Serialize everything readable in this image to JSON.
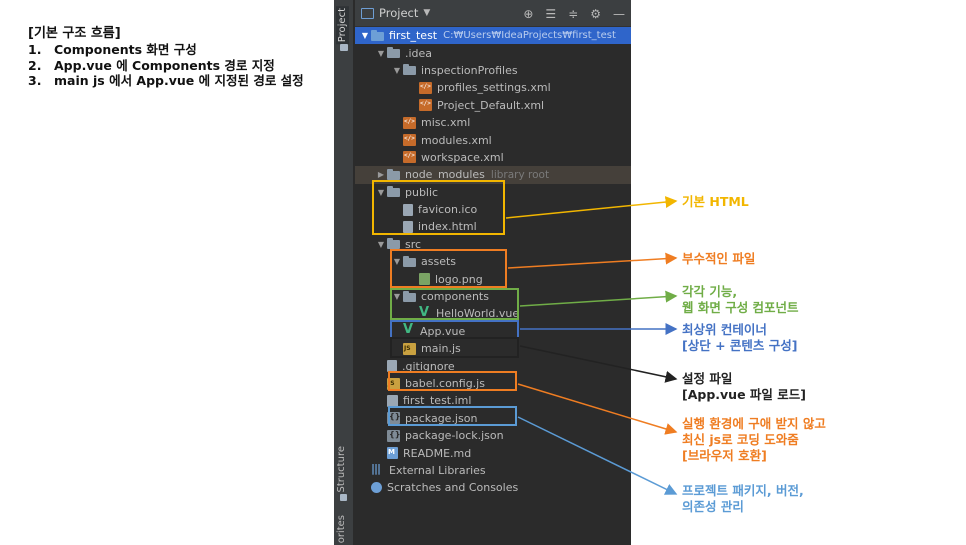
{
  "notes": {
    "title": "[기본 구조 흐름]",
    "items": [
      {
        "num": "1.",
        "text": "Components 화면 구성"
      },
      {
        "num": "2.",
        "text": "App.vue 에 Components 경로 지정"
      },
      {
        "num": "3.",
        "text": "main js 에서 App.vue 에 지정된 경로 설정"
      }
    ]
  },
  "ide": {
    "sidebar": {
      "project_tab": "Project",
      "structure_tab": "Structure",
      "favorites_tab": "orites"
    },
    "toolbar": {
      "view_label": "Project",
      "caret": "▼",
      "icons": [
        "target-icon",
        "collapse-all-icon",
        "expand-all-icon",
        "gear-icon",
        "minimize-icon"
      ]
    },
    "tree": [
      {
        "label": "first_test",
        "path": "C:₩Users₩IdeaProjects₩first_test",
        "icon": "folder-blue",
        "arrow": "▼",
        "indent": 0,
        "selected": true
      },
      {
        "label": ".idea",
        "icon": "folder",
        "arrow": "▼",
        "indent": 1
      },
      {
        "label": "inspectionProfiles",
        "icon": "folder",
        "arrow": "▼",
        "indent": 2
      },
      {
        "label": "profiles_settings.xml",
        "icon": "xml",
        "indent": 3
      },
      {
        "label": "Project_Default.xml",
        "icon": "xml",
        "indent": 3
      },
      {
        "label": "misc.xml",
        "icon": "xml",
        "indent": 2
      },
      {
        "label": "modules.xml",
        "icon": "xml",
        "indent": 2
      },
      {
        "label": "workspace.xml",
        "icon": "xml",
        "indent": 2
      },
      {
        "label": "node_modules",
        "suffix": "library root",
        "icon": "folder",
        "arrow": "▶",
        "indent": 1,
        "highlight": true
      },
      {
        "label": "public",
        "icon": "folder",
        "arrow": "▼",
        "indent": 1
      },
      {
        "label": "favicon.ico",
        "icon": "file",
        "indent": 2
      },
      {
        "label": "index.html",
        "icon": "file",
        "indent": 2
      },
      {
        "label": "src",
        "icon": "folder",
        "arrow": "▼",
        "indent": 1
      },
      {
        "label": "assets",
        "icon": "folder",
        "arrow": "▼",
        "indent": 2
      },
      {
        "label": "logo.png",
        "icon": "image",
        "indent": 3
      },
      {
        "label": "components",
        "icon": "folder",
        "arrow": "▼",
        "indent": 2
      },
      {
        "label": "HelloWorld.vue",
        "icon": "vue",
        "indent": 3
      },
      {
        "label": "App.vue",
        "icon": "vue",
        "indent": 2
      },
      {
        "label": "main.js",
        "icon": "js",
        "indent": 2
      },
      {
        "label": ".gitignore",
        "icon": "ignore",
        "indent": 1
      },
      {
        "label": "babel.config.js",
        "icon": "js",
        "indent": 1
      },
      {
        "label": "first_test.iml",
        "icon": "iml",
        "indent": 1
      },
      {
        "label": "package.json",
        "icon": "json",
        "indent": 1
      },
      {
        "label": "package-lock.json",
        "icon": "json",
        "indent": 1
      },
      {
        "label": "README.md",
        "icon": "md",
        "indent": 1
      },
      {
        "label": "External Libraries",
        "icon": "libs",
        "indent": 0
      },
      {
        "label": "Scratches and Consoles",
        "icon": "scratch",
        "indent": 0
      }
    ]
  },
  "annotations": [
    {
      "id": "public",
      "color": "#f2b600",
      "lines": [
        "기본 HTML"
      ]
    },
    {
      "id": "assets",
      "color": "#ef7d22",
      "lines": [
        "부수적인 파일"
      ]
    },
    {
      "id": "components",
      "color": "#70ad47",
      "lines": [
        "각각 기능,",
        "웹 화면 구성 컴포넌트"
      ]
    },
    {
      "id": "app-vue",
      "color": "#4472c4",
      "lines": [
        "최상위 컨테이너",
        "[상단 + 콘텐츠 구성]"
      ]
    },
    {
      "id": "main-js",
      "color": "#222222",
      "lines": [
        "설정 파일",
        "[App.vue 파일 로드]"
      ]
    },
    {
      "id": "babel",
      "color": "#ef7d22",
      "lines": [
        "실행 환경에 구애 받지 않고",
        "최신 js로 코딩 도와줌",
        "[브라우저 호환]"
      ]
    },
    {
      "id": "package",
      "color": "#5b9bd5",
      "lines": [
        "프로젝트 패키지, 버전,",
        "의존성 관리"
      ]
    }
  ]
}
